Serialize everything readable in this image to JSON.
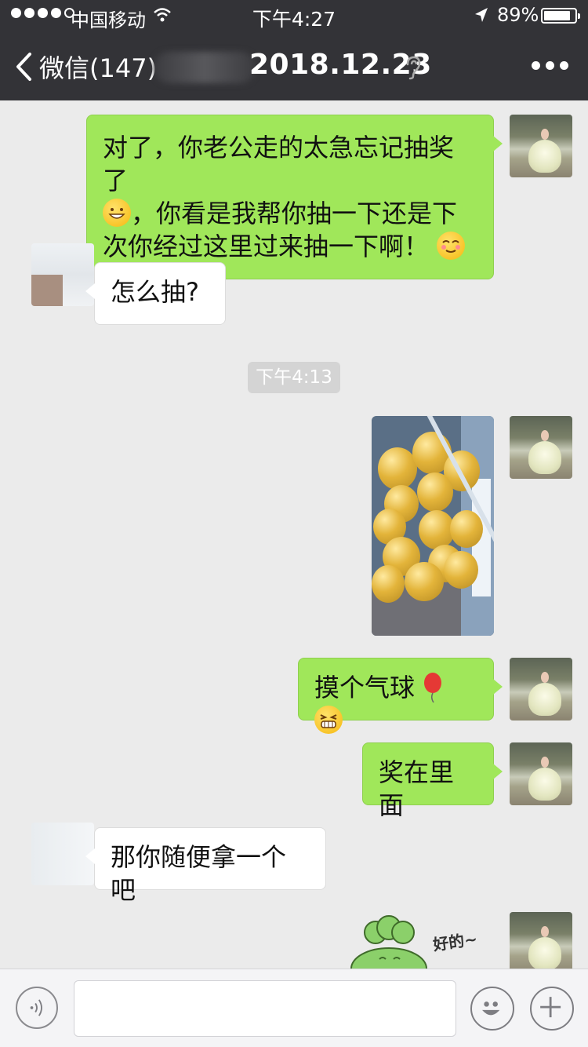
{
  "status_bar": {
    "carrier": "中国移动",
    "time": "下午4:27",
    "battery_percent": "89%",
    "battery_level": 0.89
  },
  "nav": {
    "back_label": "微信(147)",
    "title": "2018.12.23",
    "more_icon": "more-dots-icon",
    "earpiece_icon": "ear-icon"
  },
  "messages": [
    {
      "sender": "me",
      "type": "text",
      "text_lines": [
        "对了，你老公走的太急忘记抽奖了",
        "，你看是我帮你抽一下还是下",
        "次你经过这里过来抽一下啊！"
      ]
    },
    {
      "sender": "other",
      "type": "text",
      "text": "怎么抽?"
    },
    {
      "type": "timestamp",
      "text": "下午4:13"
    },
    {
      "sender": "me",
      "type": "image",
      "alt": "balloons-photo"
    },
    {
      "sender": "me",
      "type": "text",
      "text": "摸个气球"
    },
    {
      "sender": "me",
      "type": "text",
      "text": "奖在里面"
    },
    {
      "sender": "other",
      "type": "text",
      "text": "那你随便拿一个吧"
    },
    {
      "sender": "me",
      "type": "sticker",
      "text": "好的~"
    }
  ],
  "input_bar": {
    "placeholder": "",
    "voice_icon": "voice-icon",
    "emoji_icon": "emoji-icon",
    "plus_icon": "plus-icon"
  },
  "colors": {
    "nav_bg": "#333337",
    "chat_bg": "#ebebeb",
    "my_bubble": "#a0e75a",
    "other_bubble": "#ffffff"
  }
}
